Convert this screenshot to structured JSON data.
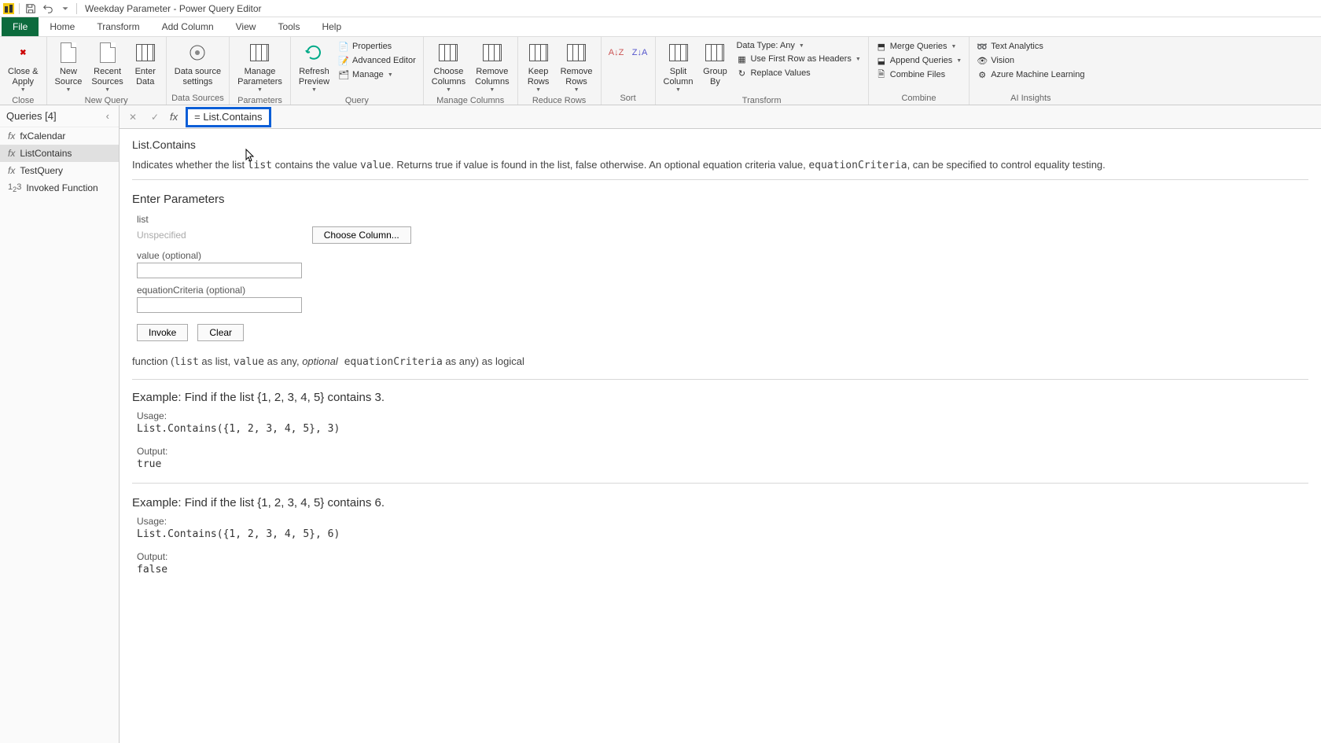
{
  "titlebar": {
    "title": "Weekday Parameter - Power Query Editor"
  },
  "menus": {
    "file": "File",
    "home": "Home",
    "transform": "Transform",
    "addcolumn": "Add Column",
    "view": "View",
    "tools": "Tools",
    "help": "Help"
  },
  "ribbon": {
    "close": "Close",
    "close_apply": "Close &\nApply",
    "new_source": "New\nSource",
    "recent_sources": "Recent\nSources",
    "enter_data": "Enter\nData",
    "new_query": "New Query",
    "data_source_settings": "Data source\nsettings",
    "data_sources": "Data Sources",
    "manage_parameters": "Manage\nParameters",
    "parameters": "Parameters",
    "refresh_preview": "Refresh\nPreview",
    "properties": "Properties",
    "advanced_editor": "Advanced Editor",
    "manage": "Manage",
    "query": "Query",
    "choose_columns": "Choose\nColumns",
    "remove_columns": "Remove\nColumns",
    "manage_columns": "Manage Columns",
    "keep_rows": "Keep\nRows",
    "remove_rows": "Remove\nRows",
    "reduce_rows": "Reduce Rows",
    "sort": "Sort",
    "split_column": "Split\nColumn",
    "group_by": "Group\nBy",
    "data_type": "Data Type: Any",
    "first_row_headers": "Use First Row as Headers",
    "replace_values": "Replace Values",
    "transform": "Transform",
    "merge_queries": "Merge Queries",
    "append_queries": "Append Queries",
    "combine_files": "Combine Files",
    "combine": "Combine",
    "text_analytics": "Text Analytics",
    "vision": "Vision",
    "azure_ml": "Azure Machine Learning",
    "ai_insights": "AI Insights"
  },
  "queries": {
    "header": "Queries [4]",
    "items": [
      {
        "icon": "fx",
        "label": "fxCalendar"
      },
      {
        "icon": "fx",
        "label": "ListContains"
      },
      {
        "icon": "fx",
        "label": "TestQuery"
      },
      {
        "icon": "123",
        "label": "Invoked Function"
      }
    ]
  },
  "formula": {
    "text": "List.Contains"
  },
  "doc": {
    "title": "List.Contains",
    "desc_pre": "Indicates whether the list ",
    "desc_list": "list",
    "desc_mid": " contains the value ",
    "desc_value": "value",
    "desc_post": ". Returns true if value is found in the list, false otherwise. An optional equation criteria value, ",
    "desc_eq": "equationCriteria",
    "desc_end": ", can be specified to control equality testing.",
    "enter_params": "Enter Parameters",
    "p_list": "list",
    "p_unspecified": "Unspecified",
    "choose_column": "Choose Column...",
    "p_value": "value (optional)",
    "p_eq": "equationCriteria (optional)",
    "invoke": "Invoke",
    "clear": "Clear",
    "sig_pre": "function (",
    "sig_list": "list",
    "sig_1": " as list, ",
    "sig_value": "value",
    "sig_2": " as any, ",
    "sig_opt": "optional",
    "sig_eq": " equationCriteria",
    "sig_3": " as any) as logical",
    "example1_h": "Example: Find if the list {1, 2, 3, 4, 5} contains 3.",
    "usage": "Usage:",
    "example1_code": "List.Contains({1, 2, 3, 4, 5}, 3)",
    "output": "Output:",
    "example1_out": "true",
    "example2_h": "Example: Find if the list {1, 2, 3, 4, 5} contains 6.",
    "example2_code": "List.Contains({1, 2, 3, 4, 5}, 6)",
    "example2_out": "false"
  }
}
